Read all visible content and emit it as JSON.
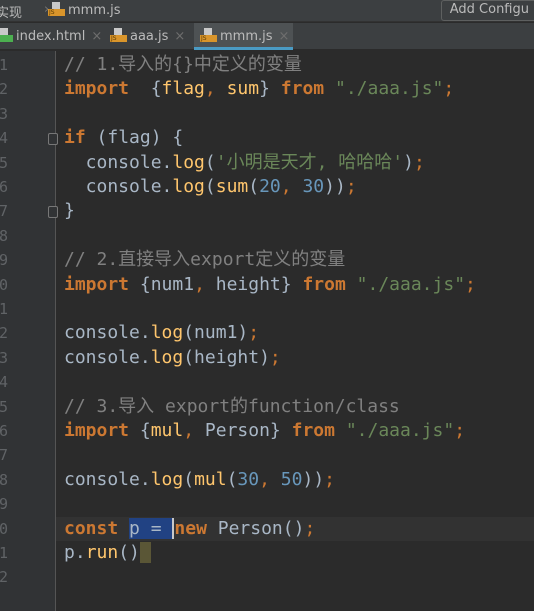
{
  "breadcrumb": {
    "parent": "实现",
    "file": "mmm.js"
  },
  "toolbar": {
    "add_config": "Add Configu"
  },
  "tabs": [
    {
      "label": "index.html",
      "icon": "html-file-icon"
    },
    {
      "label": "aaa.js",
      "icon": "js-file-icon"
    },
    {
      "label": "mmm.js",
      "icon": "js-file-icon",
      "active": true
    }
  ],
  "colors": {
    "background": "#2b2b2b",
    "keyword": "#cc7832",
    "string": "#6a8759",
    "number": "#6897bb",
    "comment": "#808080",
    "function": "#ffc66d",
    "text": "#a9b7c6",
    "selection": "#214283"
  },
  "editor": {
    "current_line": 20,
    "lines": [
      [
        [
          "cm",
          "// 1.导入的{}中定义的变量"
        ]
      ],
      [
        [
          "kw",
          "import"
        ],
        [
          "",
          "  {"
        ],
        [
          "fn",
          "flag"
        ],
        [
          "pn",
          ","
        ],
        [
          "",
          " "
        ],
        [
          "fn",
          "sum"
        ],
        [
          "",
          "} "
        ],
        [
          "kw",
          "from"
        ],
        [
          "",
          " "
        ],
        [
          "str",
          "\"./aaa.js\""
        ],
        [
          "pn",
          ";"
        ]
      ],
      [],
      [
        [
          "kw",
          "if"
        ],
        [
          "",
          " (flag) {"
        ]
      ],
      [
        [
          "",
          "  console."
        ],
        [
          "fn",
          "log"
        ],
        [
          "",
          "("
        ],
        [
          "str",
          "'小明是天才, 哈哈哈'"
        ],
        [
          "",
          ")"
        ],
        [
          "pn",
          ";"
        ]
      ],
      [
        [
          "",
          "  console."
        ],
        [
          "fn",
          "log"
        ],
        [
          "",
          "("
        ],
        [
          "fn",
          "sum"
        ],
        [
          "",
          "("
        ],
        [
          "num",
          "20"
        ],
        [
          "pn",
          ","
        ],
        [
          "",
          " "
        ],
        [
          "num",
          "30"
        ],
        [
          "",
          "))"
        ],
        [
          "pn",
          ";"
        ]
      ],
      [
        [
          "",
          "}"
        ]
      ],
      [],
      [
        [
          "cm",
          "// 2.直接导入export定义的变量"
        ]
      ],
      [
        [
          "kw",
          "import"
        ],
        [
          "",
          " {num1"
        ],
        [
          "pn",
          ","
        ],
        [
          "",
          " height} "
        ],
        [
          "kw",
          "from"
        ],
        [
          "",
          " "
        ],
        [
          "str",
          "\"./aaa.js\""
        ],
        [
          "pn",
          ";"
        ]
      ],
      [],
      [
        [
          "",
          "console."
        ],
        [
          "fn",
          "log"
        ],
        [
          "",
          "(num1)"
        ],
        [
          "pn",
          ";"
        ]
      ],
      [
        [
          "",
          "console."
        ],
        [
          "fn",
          "log"
        ],
        [
          "",
          "(height)"
        ],
        [
          "pn",
          ";"
        ]
      ],
      [],
      [
        [
          "cm",
          "// 3.导入 export的function/class"
        ]
      ],
      [
        [
          "kw",
          "import"
        ],
        [
          "",
          " {"
        ],
        [
          "fn",
          "mul"
        ],
        [
          "pn",
          ","
        ],
        [
          "",
          " Person} "
        ],
        [
          "kw",
          "from"
        ],
        [
          "",
          " "
        ],
        [
          "str",
          "\"./aaa.js\""
        ],
        [
          "pn",
          ";"
        ]
      ],
      [],
      [
        [
          "",
          "console."
        ],
        [
          "fn",
          "log"
        ],
        [
          "",
          "("
        ],
        [
          "fn",
          "mul"
        ],
        [
          "",
          "("
        ],
        [
          "num",
          "30"
        ],
        [
          "pn",
          ","
        ],
        [
          "",
          " "
        ],
        [
          "num",
          "50"
        ],
        [
          "",
          "))"
        ],
        [
          "pn",
          ";"
        ]
      ],
      [],
      [
        [
          "kw",
          "const"
        ],
        [
          "",
          " "
        ],
        [
          "sel",
          "p = "
        ],
        [
          "kw caret",
          "new"
        ],
        [
          "",
          " Person()"
        ],
        [
          "pn",
          ";"
        ]
      ],
      [
        [
          "",
          "p."
        ],
        [
          "fn",
          "run"
        ],
        [
          "",
          "()"
        ],
        [
          "endmark",
          " "
        ]
      ],
      []
    ]
  }
}
